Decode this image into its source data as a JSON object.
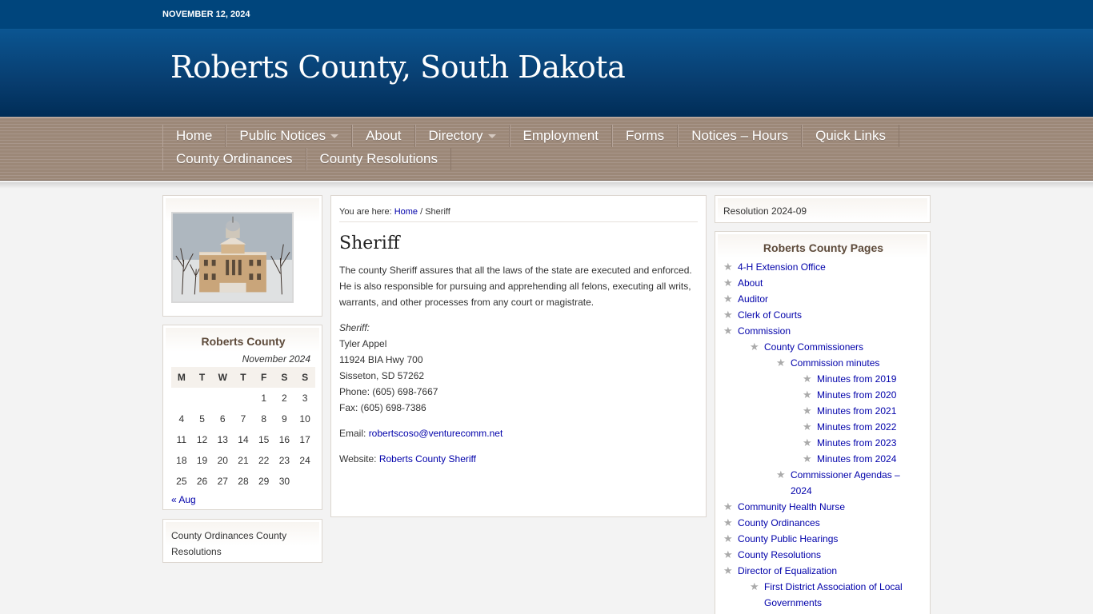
{
  "topbar": {
    "date": "NOVEMBER 12, 2024"
  },
  "site": {
    "title": "Roberts County, South Dakota"
  },
  "nav": {
    "row1": [
      {
        "label": "Home",
        "caret": false
      },
      {
        "label": "Public Notices",
        "caret": true
      },
      {
        "label": "About",
        "caret": false
      },
      {
        "label": "Directory",
        "caret": true
      },
      {
        "label": "Employment",
        "caret": false
      },
      {
        "label": "Forms",
        "caret": false
      },
      {
        "label": "Notices – Hours",
        "caret": false
      },
      {
        "label": "Quick Links",
        "caret": false
      }
    ],
    "row2": [
      {
        "label": "County Ordinances",
        "caret": false
      },
      {
        "label": "County Resolutions",
        "caret": false
      }
    ]
  },
  "calendar": {
    "title": "Roberts County",
    "caption": "November 2024",
    "weekdays": [
      "M",
      "T",
      "W",
      "T",
      "F",
      "S",
      "S"
    ],
    "weeks": [
      [
        "",
        "",
        "",
        "",
        "1",
        "2",
        "3"
      ],
      [
        "4",
        "5",
        "6",
        "7",
        "8",
        "9",
        "10"
      ],
      [
        "11",
        "12",
        "13",
        "14",
        "15",
        "16",
        "17"
      ],
      [
        "18",
        "19",
        "20",
        "21",
        "22",
        "23",
        "24"
      ],
      [
        "25",
        "26",
        "27",
        "28",
        "29",
        "30",
        ""
      ]
    ],
    "prev": "« Aug"
  },
  "left_widget": {
    "text": "County Ordinances County Resolutions"
  },
  "main": {
    "breadcrumb_prefix": "You are here: ",
    "breadcrumb_home": "Home",
    "breadcrumb_sep": " / ",
    "breadcrumb_current": "Sheriff",
    "title": "Sheriff",
    "intro": "The county Sheriff assures that all the laws of the state are executed and enforced. He is also responsible for pursuing and apprehending all felons, executing all writs, warrants, and other processes from any court or magistrate.",
    "contact_label": "Sheriff:",
    "name": "Tyler Appel",
    "address1": "11924 BIA Hwy 700",
    "address2": "Sisseton, SD  57262",
    "phone": "Phone: (605) 698-7667",
    "fax": "Fax:  (605) 698-7386",
    "email_label": "Email: ",
    "email": "robertscoso@venturecomm.net",
    "website_label": "Website: ",
    "website": "Roberts County Sheriff"
  },
  "right_widget": {
    "text": "Resolution 2024-09"
  },
  "pages": {
    "title": "Roberts County Pages",
    "items": [
      {
        "label": "4-H Extension Office",
        "level": 0
      },
      {
        "label": "About",
        "level": 0
      },
      {
        "label": "Auditor",
        "level": 0
      },
      {
        "label": "Clerk of Courts",
        "level": 0
      },
      {
        "label": "Commission",
        "level": 0
      },
      {
        "label": "County Commissioners",
        "level": 1
      },
      {
        "label": "Commission minutes",
        "level": 2
      },
      {
        "label": "Minutes from 2019",
        "level": 3
      },
      {
        "label": "Minutes from 2020",
        "level": 3
      },
      {
        "label": "Minutes from 2021",
        "level": 3
      },
      {
        "label": "Minutes from 2022",
        "level": 3
      },
      {
        "label": "Minutes from 2023",
        "level": 3
      },
      {
        "label": "Minutes from 2024",
        "level": 3
      },
      {
        "label": "Commissioner Agendas – 2024",
        "level": 2
      },
      {
        "label": "Community Health Nurse",
        "level": 0
      },
      {
        "label": "County Ordinances",
        "level": 0
      },
      {
        "label": "County Public Hearings",
        "level": 0
      },
      {
        "label": "County Resolutions",
        "level": 0
      },
      {
        "label": "Director of Equalization",
        "level": 0
      },
      {
        "label": "First District Association of Local Governments",
        "level": 1
      }
    ]
  },
  "colors": {
    "header_blue": "#00457c",
    "nav_brown": "#9c8878",
    "link_blue": "#0000aa",
    "widget_title": "#5d4a3a"
  },
  "icons": {
    "list_bullet": "star-icon",
    "dropdown": "chevron-down-icon"
  }
}
